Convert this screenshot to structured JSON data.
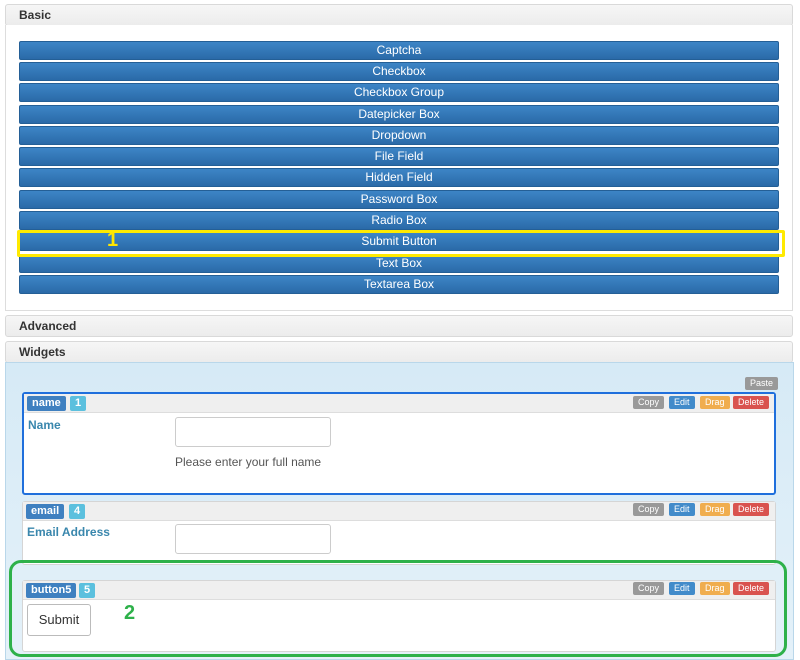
{
  "sections": {
    "basic": "Basic",
    "advanced": "Advanced",
    "widgets": "Widgets"
  },
  "field_types": [
    "Captcha",
    "Checkbox",
    "Checkbox Group",
    "Datepicker Box",
    "Dropdown",
    "File Field",
    "Hidden Field",
    "Password Box",
    "Radio Box",
    "Submit Button",
    "Text Box",
    "Textarea Box"
  ],
  "paste_label": "Paste",
  "actions": {
    "copy": "Copy",
    "edit": "Edit",
    "drag": "Drag",
    "delete": "Delete"
  },
  "widgets": [
    {
      "name": "name",
      "index": "1",
      "label": "Name",
      "help": "Please enter your full name"
    },
    {
      "name": "email",
      "index": "4",
      "label": "Email Address"
    },
    {
      "name": "button5",
      "index": "5",
      "button_label": "Submit"
    }
  ],
  "annotations": {
    "first": "1",
    "second": "2"
  },
  "colors": {
    "highlight_yellow": "#ffea00",
    "highlight_green": "#2eb14a",
    "primary": "#2a6aa8"
  }
}
